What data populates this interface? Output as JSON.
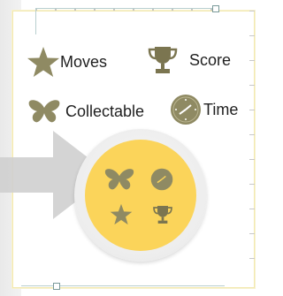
{
  "colors": {
    "icon_olive": "#8f8a63",
    "icon_dark": "#7b7550",
    "yellow": "#fbd45a",
    "arrow_gray": "#cfcfcf"
  },
  "legend": [
    {
      "label": "Moves",
      "icon": "star-icon"
    },
    {
      "label": "Score",
      "icon": "trophy-icon"
    },
    {
      "label": "Collectable",
      "icon": "butterfly-icon"
    },
    {
      "label": "Time",
      "icon": "clock-icon"
    }
  ],
  "circle_icons": [
    "butterfly-icon",
    "clock-icon",
    "star-icon",
    "trophy-icon"
  ]
}
